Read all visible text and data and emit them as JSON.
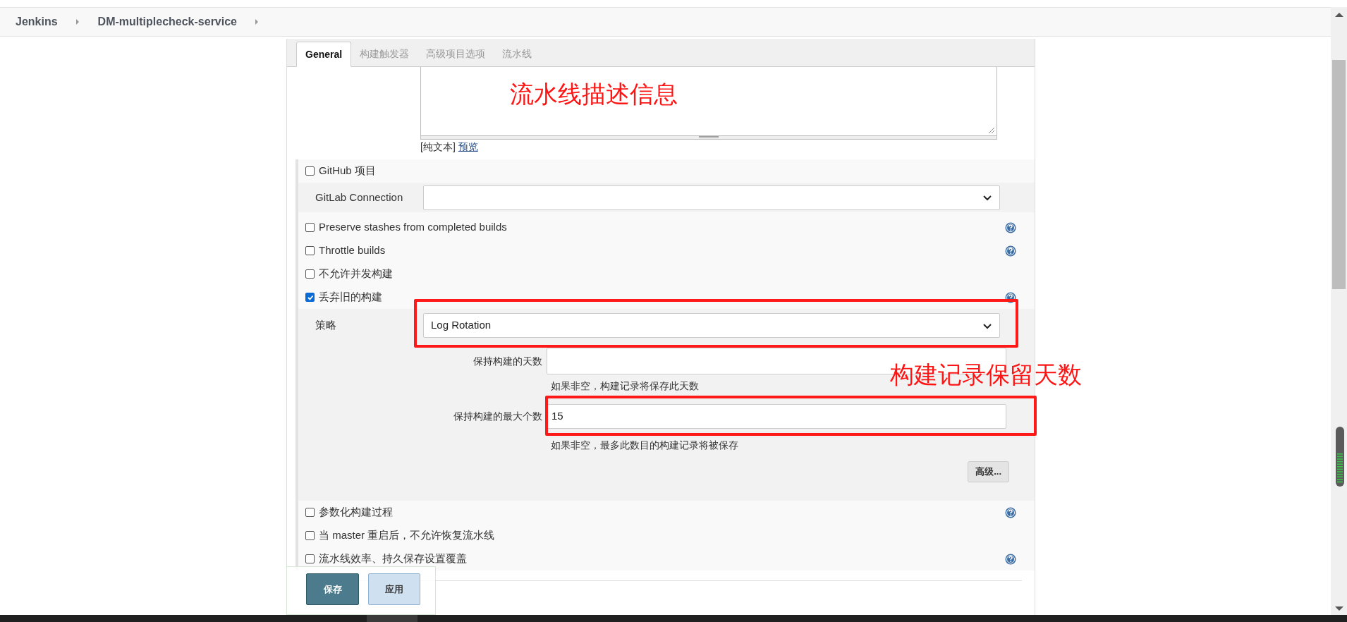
{
  "breadcrumbs": [
    {
      "label": "Jenkins"
    },
    {
      "label": "DM-multiplecheck-service"
    }
  ],
  "tabs": [
    {
      "label": "General",
      "selected": true
    },
    {
      "label": "构建触发器",
      "selected": false
    },
    {
      "label": "高级项目选项",
      "selected": false
    },
    {
      "label": "流水线",
      "selected": false
    }
  ],
  "description": {
    "format_label": "[纯文本]",
    "preview_link": "预览"
  },
  "options": [
    {
      "kind": "checkbox",
      "label": "GitHub 项目",
      "checked": false,
      "help": false
    },
    {
      "kind": "select",
      "label": "GitLab Connection"
    },
    {
      "kind": "checkbox",
      "label": "Preserve stashes from completed builds",
      "checked": false,
      "help": true
    },
    {
      "kind": "checkbox",
      "label": "Throttle builds",
      "checked": false,
      "help": true
    },
    {
      "kind": "checkbox",
      "label": "不允许并发构建",
      "checked": false,
      "help": false
    },
    {
      "kind": "discard",
      "label": "丢弃旧的构建",
      "checked": true,
      "help": true,
      "strategy": {
        "label": "策略",
        "value": "Log Rotation"
      },
      "fields": [
        {
          "label": "保持构建的天数",
          "hint": "如果非空，构建记录将保存此天数"
        },
        {
          "label": "保持构建的最大个数",
          "value": "15",
          "hint": "如果非空，最多此数目的构建记录将被保存"
        }
      ],
      "advanced_button": "高级..."
    },
    {
      "kind": "checkbox",
      "label": "参数化构建过程",
      "checked": false,
      "help": true
    },
    {
      "kind": "checkbox",
      "label": "当 master 重启后，不允许恢复流水线",
      "checked": false,
      "help": false
    },
    {
      "kind": "checkbox",
      "label": "流水线效率、持久保存设置覆盖",
      "checked": false,
      "help": true
    }
  ],
  "annotations": [
    {
      "text": "流水线描述信息"
    },
    {
      "text": "构建记录保留天数"
    }
  ],
  "buttons": [
    {
      "label": "保存",
      "kind": "primary"
    },
    {
      "label": "应用",
      "kind": "secondary"
    }
  ]
}
